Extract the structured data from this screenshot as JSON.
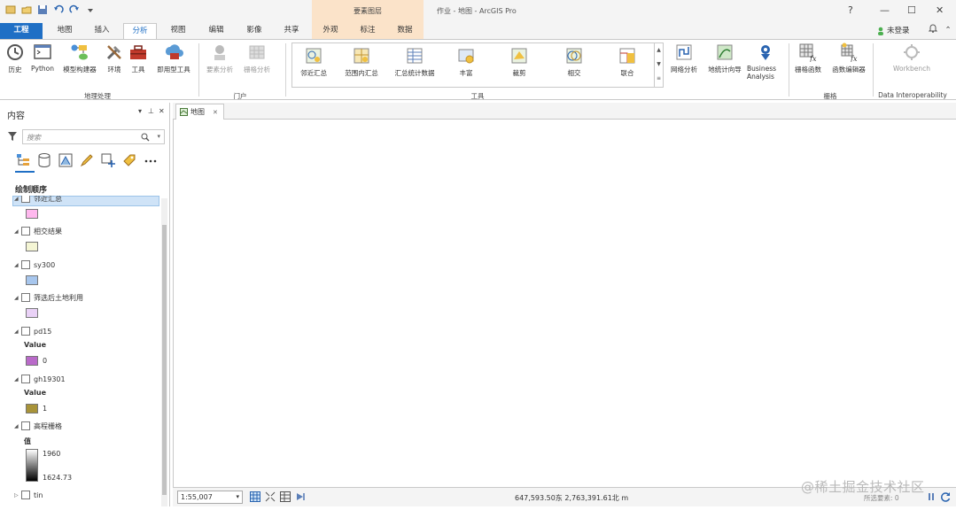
{
  "title_bar": {
    "contextual_group": "要素图层",
    "window_title": "作业 - 地图 - ArcGIS Pro",
    "help": "?",
    "minimize": "—",
    "maximize": "☐",
    "close": "✕"
  },
  "tabs": [
    "工程",
    "地图",
    "插入",
    "分析",
    "视图",
    "编辑",
    "影像",
    "共享",
    "外观",
    "标注",
    "数据"
  ],
  "account": {
    "login": "未登录",
    "bell": "🔔"
  },
  "ribbon": {
    "geoprocessing": {
      "label": "地理处理",
      "buttons": [
        "历史",
        "Python",
        "模型构建器",
        "环境",
        "工具",
        "即用型工具"
      ]
    },
    "portal": {
      "label": "门户",
      "buttons": [
        "要素分析",
        "栅格分析"
      ]
    },
    "tools": {
      "label": "工具",
      "items": [
        "邻近汇总",
        "范围内汇总",
        "汇总统计数据",
        "丰富",
        "裁剪",
        "相交",
        "联合"
      ]
    },
    "analysis": {
      "buttons": [
        "网络分析",
        "地统计向导",
        "Business Analysis"
      ]
    },
    "raster": {
      "label": "栅格",
      "buttons": [
        "栅格函数",
        "函数编辑器"
      ]
    },
    "interop": {
      "label": "Data Interoperability",
      "buttons": [
        "Workbench"
      ]
    }
  },
  "contents": {
    "title": "内容",
    "search_placeholder": "搜索",
    "section": "绘制顺序",
    "layers": [
      {
        "name": "邻近汇总",
        "swatch": "#ffb8ee"
      },
      {
        "name": "相交结果",
        "swatch": "#f4f5d4"
      },
      {
        "name": "sy300",
        "swatch": "#a7c6ed"
      },
      {
        "name": "筛选后土地利用",
        "swatch": "#ead2f7"
      },
      {
        "name": "pd15",
        "legend_title": "Value",
        "value": "0",
        "swatch": "#b96ac9"
      },
      {
        "name": "gh19301",
        "legend_title": "Value",
        "value": "1",
        "swatch": "#a89339"
      },
      {
        "name": "高程栅格",
        "legend_title": "值",
        "max": "1960",
        "min": "1624.73"
      },
      {
        "name": "tin"
      }
    ]
  },
  "map": {
    "tab": "地图"
  },
  "status": {
    "scale": "1:55,007",
    "coordinates": "647,593.50东 2,763,391.61北 m",
    "selected": "所选要素: 0"
  },
  "watermark": "@稀土掘金技术社区"
}
